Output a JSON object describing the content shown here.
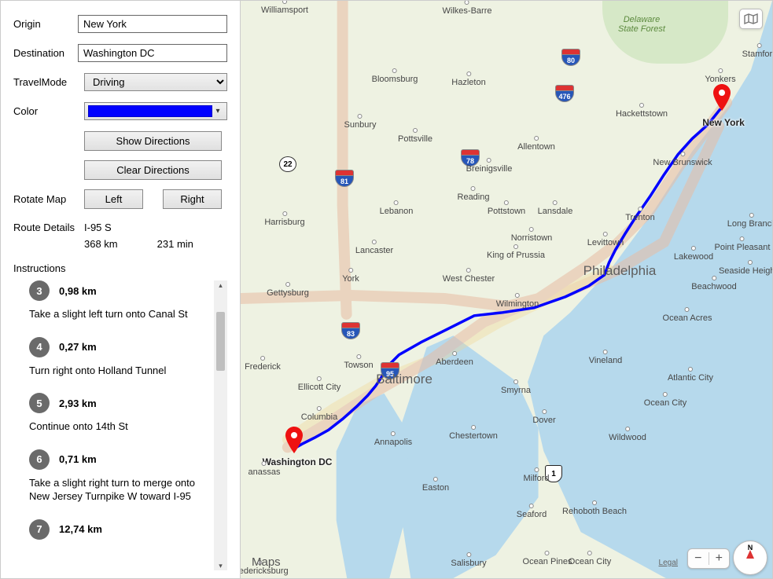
{
  "form": {
    "origin_label": "Origin",
    "origin_value": "New York",
    "destination_label": "Destination",
    "destination_value": "Washington DC",
    "travelmode_label": "TravelMode",
    "travelmode_value": "Driving",
    "color_label": "Color",
    "color_value": "#0000ff",
    "show_directions": "Show Directions",
    "clear_directions": "Clear Directions",
    "rotate_label": "Rotate Map",
    "rotate_left": "Left",
    "rotate_right": "Right"
  },
  "route_details": {
    "label": "Route Details",
    "name": "I-95 S",
    "distance": "368 km",
    "duration": "231 min"
  },
  "instructions": {
    "label": "Instructions",
    "steps": [
      {
        "num": "3",
        "dist": "0,98 km",
        "text": "Take a slight left turn onto Canal St"
      },
      {
        "num": "4",
        "dist": "0,27 km",
        "text": "Turn right onto Holland Tunnel"
      },
      {
        "num": "5",
        "dist": "2,93 km",
        "text": "Continue onto 14th St"
      },
      {
        "num": "6",
        "dist": "0,71 km",
        "text": "Take a slight right turn to merge onto New Jersey Turnpike W toward I-95"
      },
      {
        "num": "7",
        "dist": "12,74 km",
        "text": ""
      }
    ]
  },
  "map": {
    "pins": {
      "origin": {
        "label": "New York"
      },
      "destination": {
        "label": "Washington DC"
      }
    },
    "cities_small": [
      "Williamsport",
      "Wilkes-Barre",
      "Stamford",
      "Yonkers",
      "Hackettstown",
      "Sunbury",
      "Bloomsburg",
      "Hazleton",
      "Allentown",
      "Breinigsville",
      "New Brunswick",
      "Reading",
      "Lebanon",
      "Harrisburg",
      "Lancaster",
      "Pottstown",
      "Lansdale",
      "Norristown",
      "King of Prussia",
      "Trenton",
      "Levittown",
      "Long Branch",
      "Lakewood",
      "Point Pleasant",
      "Seaside Heights",
      "Beachwood",
      "Ocean Acres",
      "West Chester",
      "Wilmington",
      "York",
      "Gettysburg",
      "Frederick",
      "Towson",
      "Aberdeen",
      "Ellicott City",
      "Columbia",
      "Annapolis",
      "Chestertown",
      "Dover",
      "Smyrna",
      "Vineland",
      "Atlantic City",
      "Ocean City",
      "Wildwood",
      "Milford",
      "Easton",
      "Seaford",
      "Rehoboth Beach",
      "Salisbury",
      "Ocean Pines",
      "Ocean City",
      "anassas",
      "Fredericksburg",
      "Pottsville"
    ],
    "cities_big": [
      "Philadelphia",
      "Baltimore"
    ],
    "forest_label": "Delaware\nState Forest",
    "shields_interstate": [
      "80",
      "78",
      "476",
      "81",
      "83",
      "95",
      "22"
    ],
    "shields_us": [
      "1"
    ],
    "brand": "Maps",
    "legal": "Legal",
    "zoom_out": "−",
    "zoom_in": "+",
    "compass": "N"
  }
}
